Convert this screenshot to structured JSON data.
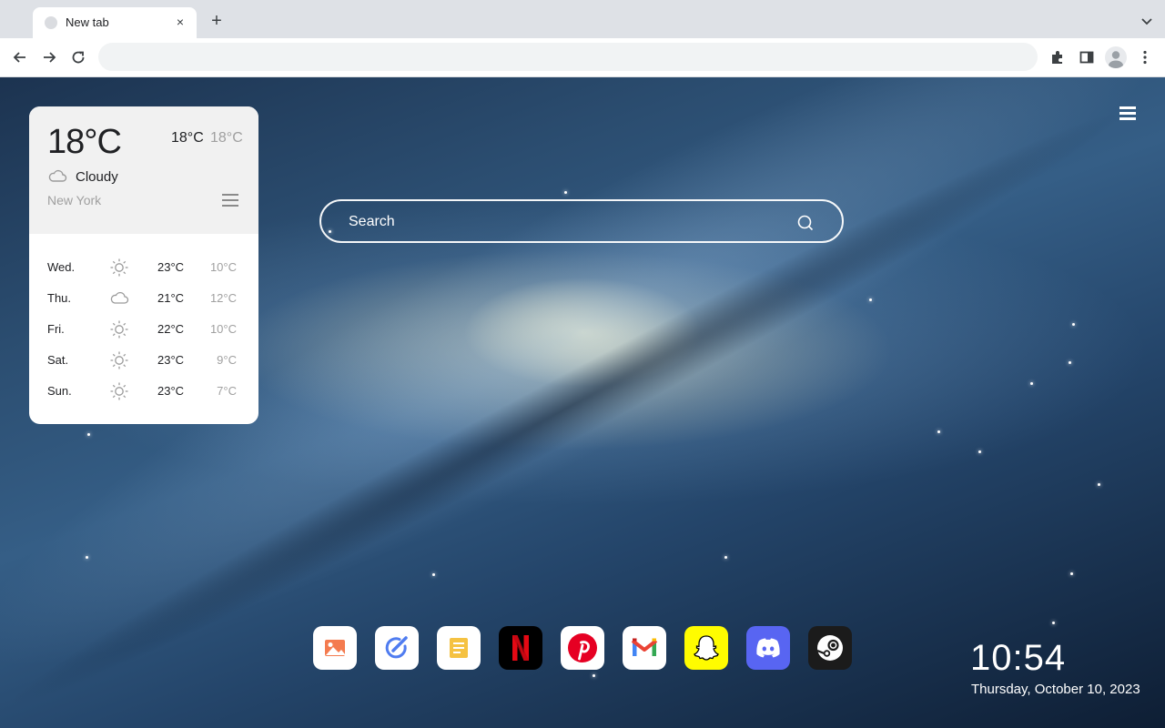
{
  "browser": {
    "tab": {
      "title": "New tab",
      "close_glyph": "×"
    },
    "new_tab_glyph": "+",
    "icons": [
      "back-icon",
      "forward-icon",
      "reload-icon",
      "extensions-icon",
      "side-panel-icon",
      "profile-icon",
      "more-menu-icon",
      "tab-search-icon"
    ]
  },
  "weather": {
    "current_temp": "18°C",
    "high": "18°C",
    "low": "18°C",
    "condition": "Cloudy",
    "condition_icon": "cloud-icon",
    "city": "New York",
    "forecast": [
      {
        "day": "Wed.",
        "icon": "sun-icon",
        "high": "23°C",
        "low": "10°C"
      },
      {
        "day": "Thu.",
        "icon": "cloud-icon",
        "high": "21°C",
        "low": "12°C"
      },
      {
        "day": "Fri.",
        "icon": "sun-icon",
        "high": "22°C",
        "low": "10°C"
      },
      {
        "day": "Sat.",
        "icon": "sun-icon",
        "high": "23°C",
        "low": "9°C"
      },
      {
        "day": "Sun.",
        "icon": "sun-icon",
        "high": "23°C",
        "low": "7°C"
      }
    ]
  },
  "search": {
    "placeholder": "Search",
    "icon": "search-icon"
  },
  "dock": {
    "apps": [
      {
        "name": "photos-app",
        "icon": "image-icon",
        "color": "#ffffff"
      },
      {
        "name": "edit-app",
        "icon": "pen-check-icon",
        "color": "#ffffff"
      },
      {
        "name": "notes-app",
        "icon": "note-icon",
        "color": "#ffffff"
      },
      {
        "name": "netflix-app",
        "icon": "netflix-icon",
        "color": "#000000"
      },
      {
        "name": "pinterest-app",
        "icon": "pinterest-icon",
        "color": "#ffffff"
      },
      {
        "name": "gmail-app",
        "icon": "gmail-icon",
        "color": "#ffffff"
      },
      {
        "name": "snapchat-app",
        "icon": "snapchat-icon",
        "color": "#fffc00"
      },
      {
        "name": "discord-app",
        "icon": "discord-icon",
        "color": "#5865f2"
      },
      {
        "name": "steam-app",
        "icon": "steam-icon",
        "color": "#1b1b1b"
      }
    ]
  },
  "clock": {
    "time": "10:54",
    "date": "Thursday, October 10, 2023"
  },
  "colors": {
    "accent_netflix": "#e50914",
    "accent_pinterest": "#e60023",
    "accent_gmail": "#ea4335"
  }
}
